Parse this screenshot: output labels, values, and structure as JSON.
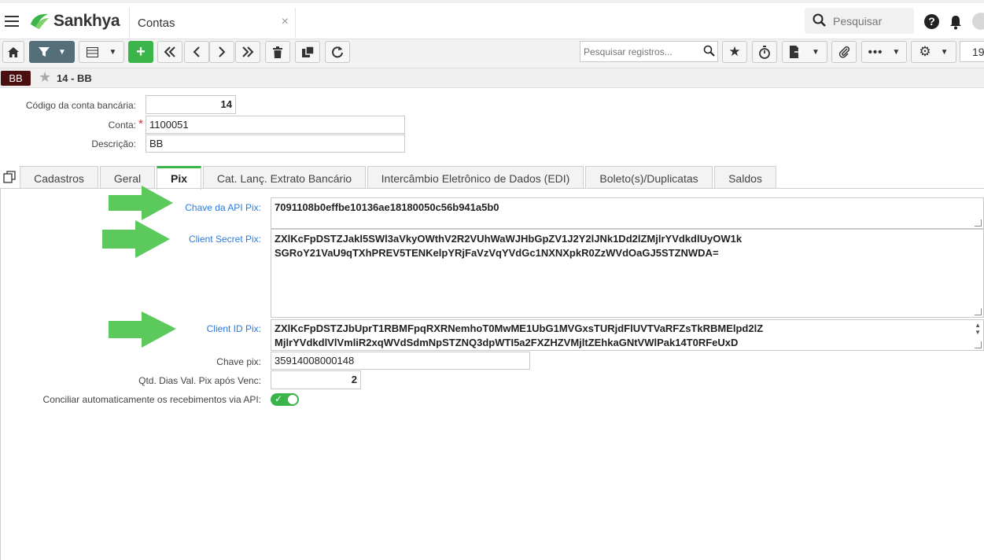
{
  "app": {
    "name": "Sankhya"
  },
  "window_tab": {
    "label": "Contas",
    "close": "×"
  },
  "header": {
    "search_label": "Pesquisar",
    "help": "?"
  },
  "toolbar": {
    "search_placeholder": "Pesquisar registros...",
    "page_number": "19"
  },
  "breadcrumb": {
    "badge": "BB",
    "title": "14 - BB"
  },
  "form": {
    "codigo_label": "Código da conta bancária:",
    "codigo_value": "14",
    "conta_label": "Conta:",
    "conta_required": "*",
    "conta_value": "1100051",
    "descricao_label": "Descrição:",
    "descricao_value": "BB"
  },
  "tabs": [
    {
      "label": "Cadastros"
    },
    {
      "label": "Geral"
    },
    {
      "label": "Pix",
      "active": true
    },
    {
      "label": "Cat. Lanç. Extrato Bancário"
    },
    {
      "label": "Intercâmbio Eletrônico de Dados (EDI)"
    },
    {
      "label": "Boleto(s)/Duplicatas"
    },
    {
      "label": "Saldos"
    }
  ],
  "pix": {
    "chave_api_label": "Chave da API Pix:",
    "chave_api_value": "7091108b0effbe10136ae18180050c56b941a5b0",
    "client_secret_label": "Client Secret Pix:",
    "client_secret_line1": "ZXlKcFpDSTZJakl5SWl3aVkyOWthV2R2VUhWaWJHbGpZV1J2Y2lJNk1Dd2lZMjlrYVdkdlUyOW1k",
    "client_secret_line2": "SGRoY21VaU9qTXhPREV5TENKelpYRjFaVzVqYVdGc1NXNXpkR0ZzWVdOaGJ5STZNWDA=",
    "client_id_label": "Client ID Pix:",
    "client_id_line1": "ZXlKcFpDSTZJbUprT1RBMFpqRXRNemhoT0MwME1UbG1MVGxsTURjdFlUVTVaRFZsTkRBMElpd2lZ",
    "client_id_line2": "MjlrYVdkdlVlVmliR2xqWVdSdmNpSTZNQ3dpWTI5a2FXZHZVMjltZEhkaGNtVWlPak14T0RFeUxD",
    "chave_pix_label": "Chave pix:",
    "chave_pix_value": "35914008000148",
    "qtd_dias_label": "Qtd. Dias Val. Pix após Venc:",
    "qtd_dias_value": "2",
    "conciliar_label": "Conciliar automaticamente os recebimentos via API:",
    "conciliar_enabled": true
  },
  "colors": {
    "accent_green": "#3bb54a",
    "link_blue": "#2a7ae2",
    "badge_bg": "#4a0f0f",
    "arrow_green": "#5cc95c"
  },
  "icons": [
    "menu-icon",
    "sankhya-logo-icon",
    "search-icon",
    "help-icon",
    "bell-icon",
    "home-icon",
    "filter-icon",
    "grid-icon",
    "add-icon",
    "first-icon",
    "prev-icon",
    "next-icon",
    "last-icon",
    "trash-icon",
    "copy-icon",
    "refresh-icon",
    "star-icon",
    "timer-icon",
    "export-icon",
    "clip-icon",
    "more-icon",
    "gear-icon"
  ]
}
